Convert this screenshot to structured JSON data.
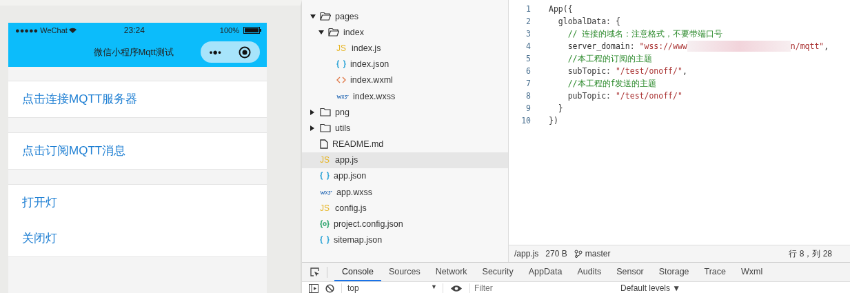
{
  "phone": {
    "status_bar": {
      "carrier": "●●●●● WeChat",
      "time": "23:24",
      "battery": "100%"
    },
    "nav_title": "微信小程序Mqtt测试",
    "menu_glyph": "•●•",
    "sections": [
      {
        "items": [
          {
            "label": "点击连接MQTT服务器"
          }
        ]
      },
      {
        "items": [
          {
            "label": "点击订阅MQTT消息"
          }
        ]
      },
      {
        "items": [
          {
            "label": "打开灯"
          },
          {
            "label": "关闭灯"
          }
        ]
      }
    ]
  },
  "file_tree": [
    {
      "name": "pages",
      "kind": "folder",
      "expanded": true,
      "selected": false,
      "children": [
        {
          "name": "index",
          "kind": "folder",
          "expanded": true,
          "selected": false,
          "children": [
            {
              "name": "index.js",
              "kind": "js",
              "icon_text": "JS",
              "selected": false
            },
            {
              "name": "index.json",
              "kind": "json",
              "selected": false
            },
            {
              "name": "index.wxml",
              "kind": "wxml",
              "selected": false
            },
            {
              "name": "index.wxss",
              "kind": "wxss",
              "selected": false
            }
          ]
        }
      ]
    },
    {
      "name": "png",
      "kind": "folder",
      "expanded": false,
      "selected": false
    },
    {
      "name": "utils",
      "kind": "folder",
      "expanded": false,
      "selected": false
    },
    {
      "name": "README.md",
      "kind": "md",
      "selected": false
    },
    {
      "name": "app.js",
      "kind": "js",
      "icon_text": "JS",
      "selected": true
    },
    {
      "name": "app.json",
      "kind": "json",
      "selected": false
    },
    {
      "name": "app.wxss",
      "kind": "wxss",
      "selected": false
    },
    {
      "name": "config.js",
      "kind": "js",
      "icon_text": "JS",
      "selected": false
    },
    {
      "name": "project.config.json",
      "kind": "config",
      "selected": false
    },
    {
      "name": "sitemap.json",
      "kind": "json",
      "selected": false
    }
  ],
  "editor": {
    "lines": [
      {
        "number": "1",
        "segments": [
          {
            "kind": "plain",
            "text": "App({"
          }
        ]
      },
      {
        "number": "2",
        "segments": [
          {
            "kind": "plain",
            "text": "  globalData: {"
          }
        ]
      },
      {
        "number": "3",
        "segments": [
          {
            "kind": "comment",
            "text": "    // 连接的域名：注意格式，不要带端口号"
          }
        ]
      },
      {
        "number": "4",
        "segments": [
          {
            "kind": "plain",
            "text": "    server_domain: "
          },
          {
            "kind": "string",
            "text": "\"wss://www"
          },
          {
            "kind": "redacted"
          },
          {
            "kind": "string",
            "text": "n/mqtt\""
          },
          {
            "kind": "plain",
            "text": ","
          }
        ]
      },
      {
        "number": "5",
        "segments": [
          {
            "kind": "comment",
            "text": "    //本工程的订阅的主题"
          }
        ]
      },
      {
        "number": "6",
        "segments": [
          {
            "kind": "plain",
            "text": "    subTopic: "
          },
          {
            "kind": "string",
            "text": "\"/test/onoff/\""
          },
          {
            "kind": "plain",
            "text": ","
          }
        ]
      },
      {
        "number": "7",
        "segments": [
          {
            "kind": "comment",
            "text": "    //本工程的f发送的主题"
          }
        ]
      },
      {
        "number": "8",
        "segments": [
          {
            "kind": "plain",
            "text": "    pubTopic: "
          },
          {
            "kind": "string",
            "text": "\"/test/onoff/\""
          }
        ]
      },
      {
        "number": "9",
        "segments": [
          {
            "kind": "plain",
            "text": "  }"
          }
        ]
      },
      {
        "number": "10",
        "segments": [
          {
            "kind": "plain",
            "text": "})"
          }
        ]
      }
    ],
    "status": {
      "path": "/app.js",
      "size": "270 B",
      "branch": "master",
      "cursor": "行 8，列 28"
    }
  },
  "devtools": {
    "tabs": [
      {
        "label": "Console",
        "selected": true
      },
      {
        "label": "Sources",
        "selected": false
      },
      {
        "label": "Network",
        "selected": false
      },
      {
        "label": "Security",
        "selected": false
      },
      {
        "label": "AppData",
        "selected": false
      },
      {
        "label": "Audits",
        "selected": false
      },
      {
        "label": "Sensor",
        "selected": false
      },
      {
        "label": "Storage",
        "selected": false
      },
      {
        "label": "Trace",
        "selected": false
      },
      {
        "label": "Wxml",
        "selected": false
      }
    ],
    "context": "top",
    "filter": {
      "placeholder": "Filter"
    },
    "levels": "Default levels ▼",
    "select_arrow": "▼"
  }
}
